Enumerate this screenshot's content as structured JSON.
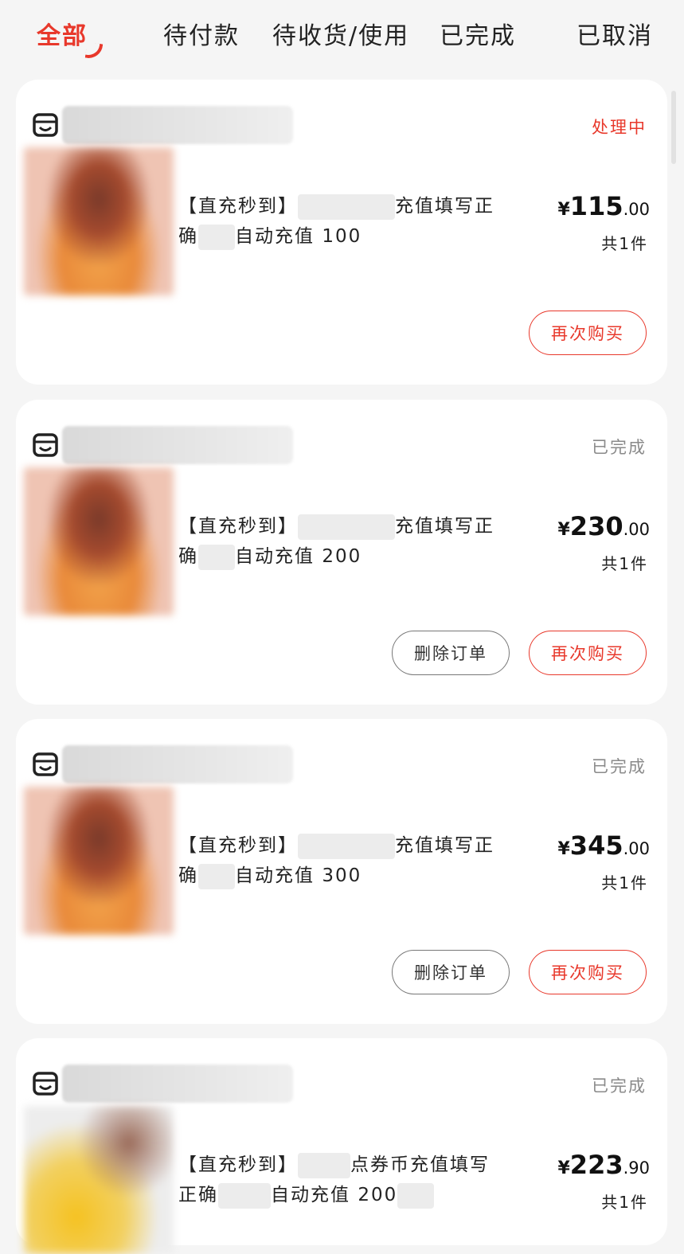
{
  "tabs": [
    {
      "label": "全部",
      "active": true
    },
    {
      "label": "待付款",
      "active": false
    },
    {
      "label": "待收货/使用",
      "active": false
    },
    {
      "label": "已完成",
      "active": false
    },
    {
      "label": "已取消",
      "active": false
    }
  ],
  "icons": {
    "shop": "shop-icon"
  },
  "colors": {
    "accent": "#e8382b",
    "status_gray": "#8a8a8a",
    "background": "#f5f5f5"
  },
  "orders": [
    {
      "status": "处理中",
      "title_prefix": "【直充秒到】",
      "title_mid": "充值填写正",
      "title_line2_a": "确",
      "title_line2_b": "自动充值",
      "amount": "100",
      "currency": "¥",
      "price_int": "115",
      "price_dec": ".00",
      "qty": "共1件",
      "buy_again": "再次购买"
    },
    {
      "status": "已完成",
      "title_prefix": "【直充秒到】",
      "title_mid": "充值填写正",
      "title_line2_a": "确",
      "title_line2_b": "自动充值",
      "amount": "200",
      "currency": "¥",
      "price_int": "230",
      "price_dec": ".00",
      "qty": "共1件",
      "delete": "删除订单",
      "buy_again": "再次购买"
    },
    {
      "status": "已完成",
      "title_prefix": "【直充秒到】",
      "title_mid": "充值填写正",
      "title_line2_a": "确",
      "title_line2_b": "自动充值",
      "amount": "300",
      "currency": "¥",
      "price_int": "345",
      "price_dec": ".00",
      "qty": "共1件",
      "delete": "删除订单",
      "buy_again": "再次购买"
    },
    {
      "status": "已完成",
      "title_prefix": "【直充秒到】",
      "title_mid": "点券币充值填写",
      "title_line2_a": "正确",
      "title_line2_b": "自动充值",
      "amount": "200",
      "currency": "¥",
      "price_int": "223",
      "price_dec": ".90",
      "qty": "共1件"
    }
  ]
}
